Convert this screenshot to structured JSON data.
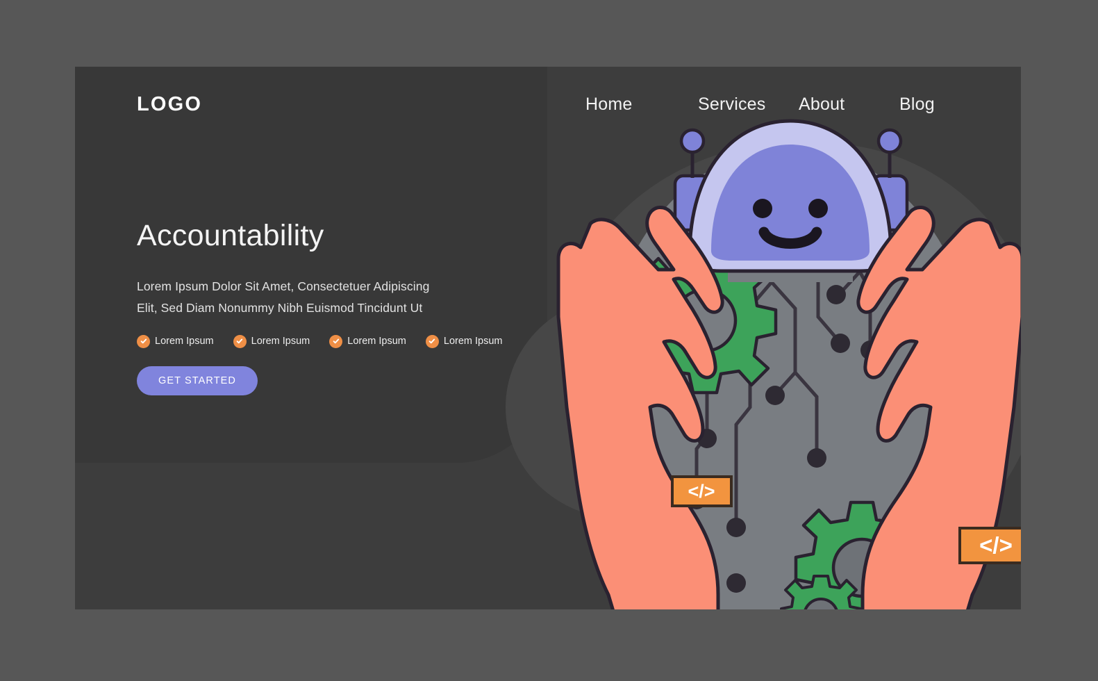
{
  "page": {
    "background_color": "#575757",
    "panel_color": "#3d3d3d"
  },
  "header": {
    "logo": "LOGO",
    "nav": [
      {
        "label": "Home"
      },
      {
        "label": "Services"
      },
      {
        "label": "About"
      },
      {
        "label": "Blog"
      }
    ]
  },
  "hero": {
    "title": "Accountability",
    "subtitle": "Lorem Ipsum Dolor Sit Amet, Consectetuer Adipiscing Elit, Sed Diam Nonummy Nibh Euismod Tincidunt Ut",
    "features": [
      {
        "label": "Lorem Ipsum",
        "icon": "check-circle-icon"
      },
      {
        "label": "Lorem Ipsum",
        "icon": "check-circle-icon"
      },
      {
        "label": "Lorem Ipsum",
        "icon": "check-circle-icon"
      },
      {
        "label": "Lorem Ipsum",
        "icon": "check-circle-icon"
      }
    ],
    "cta_label": "GET STARTED"
  },
  "illustration": {
    "alt": "robot-in-hands-illustration",
    "badges": [
      {
        "text": "</>",
        "name": "code-badge-left"
      },
      {
        "text": "</>",
        "name": "code-badge-right"
      }
    ],
    "colors": {
      "accent_purple": "#8084dd",
      "robot_shell": "#c5c6ef",
      "robot_face": "#7f83d8",
      "hand": "#fb8f76",
      "gear_green": "#3da35a",
      "circle_gray": "#797d82",
      "badge_orange": "#f2943f",
      "check_orange": "#ef8f46",
      "outline": "#2a2230"
    }
  }
}
